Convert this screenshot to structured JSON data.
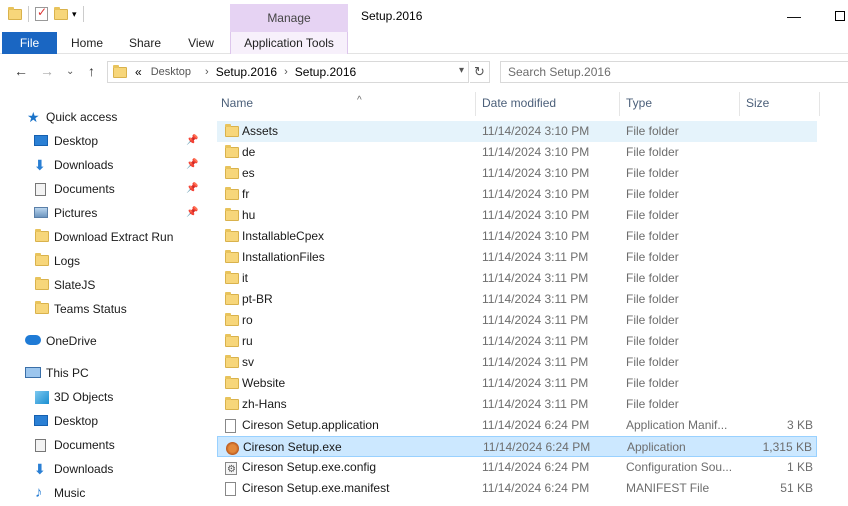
{
  "titlebar": {
    "context_tab": "Manage",
    "window_title": "Setup.2016",
    "minimize": "—",
    "qa_dropdown": "▾"
  },
  "ribbon": {
    "tabs": [
      "File",
      "Home",
      "Share",
      "View"
    ],
    "context_tools": "Application Tools"
  },
  "address": {
    "overflow": "«",
    "crumbs": [
      "Desktop",
      "Setup.2016",
      "Setup.2016"
    ],
    "separator": "›",
    "dropdown": "▾",
    "refresh": "↻",
    "search_placeholder": "Search Setup.2016"
  },
  "nav_buttons": {
    "back": "←",
    "forward": "→",
    "recent": "⌄",
    "up": "↑"
  },
  "sidebar": {
    "quick_access": "Quick access",
    "pin_glyph": "📌",
    "pinned": [
      "Desktop",
      "Downloads",
      "Documents",
      "Pictures"
    ],
    "folders": [
      "Download Extract Run",
      "Logs",
      "SlateJS",
      "Teams Status"
    ],
    "onedrive": "OneDrive",
    "this_pc": "This PC",
    "pc_items": [
      "3D Objects",
      "Desktop",
      "Documents",
      "Downloads",
      "Music"
    ]
  },
  "columns": {
    "name": "Name",
    "date": "Date modified",
    "type": "Type",
    "size": "Size",
    "sort_indicator": "^"
  },
  "files": [
    {
      "name": "Assets",
      "date": "11/14/2024 3:10 PM",
      "type": "File folder",
      "size": "",
      "icon": "folder-icon"
    },
    {
      "name": "de",
      "date": "11/14/2024 3:10 PM",
      "type": "File folder",
      "size": "",
      "icon": "folder-icon"
    },
    {
      "name": "es",
      "date": "11/14/2024 3:10 PM",
      "type": "File folder",
      "size": "",
      "icon": "folder-icon"
    },
    {
      "name": "fr",
      "date": "11/14/2024 3:10 PM",
      "type": "File folder",
      "size": "",
      "icon": "folder-icon"
    },
    {
      "name": "hu",
      "date": "11/14/2024 3:10 PM",
      "type": "File folder",
      "size": "",
      "icon": "folder-icon"
    },
    {
      "name": "InstallableCpex",
      "date": "11/14/2024 3:10 PM",
      "type": "File folder",
      "size": "",
      "icon": "folder-icon"
    },
    {
      "name": "InstallationFiles",
      "date": "11/14/2024 3:11 PM",
      "type": "File folder",
      "size": "",
      "icon": "folder-icon"
    },
    {
      "name": "it",
      "date": "11/14/2024 3:11 PM",
      "type": "File folder",
      "size": "",
      "icon": "folder-icon"
    },
    {
      "name": "pt-BR",
      "date": "11/14/2024 3:11 PM",
      "type": "File folder",
      "size": "",
      "icon": "folder-icon"
    },
    {
      "name": "ro",
      "date": "11/14/2024 3:11 PM",
      "type": "File folder",
      "size": "",
      "icon": "folder-icon"
    },
    {
      "name": "ru",
      "date": "11/14/2024 3:11 PM",
      "type": "File folder",
      "size": "",
      "icon": "folder-icon"
    },
    {
      "name": "sv",
      "date": "11/14/2024 3:11 PM",
      "type": "File folder",
      "size": "",
      "icon": "folder-icon"
    },
    {
      "name": "Website",
      "date": "11/14/2024 3:11 PM",
      "type": "File folder",
      "size": "",
      "icon": "folder-icon"
    },
    {
      "name": "zh-Hans",
      "date": "11/14/2024 3:11 PM",
      "type": "File folder",
      "size": "",
      "icon": "folder-icon"
    },
    {
      "name": "Cireson Setup.application",
      "date": "11/14/2024 6:24 PM",
      "type": "Application Manif...",
      "size": "3 KB",
      "icon": "file-icon"
    },
    {
      "name": "Cireson Setup.exe",
      "date": "11/14/2024 6:24 PM",
      "type": "Application",
      "size": "1,315 KB",
      "icon": "app-icon"
    },
    {
      "name": "Cireson Setup.exe.config",
      "date": "11/14/2024 6:24 PM",
      "type": "Configuration Sou...",
      "size": "1 KB",
      "icon": "config-icon"
    },
    {
      "name": "Cireson Setup.exe.manifest",
      "date": "11/14/2024 6:24 PM",
      "type": "MANIFEST File",
      "size": "51 KB",
      "icon": "file-icon"
    }
  ]
}
